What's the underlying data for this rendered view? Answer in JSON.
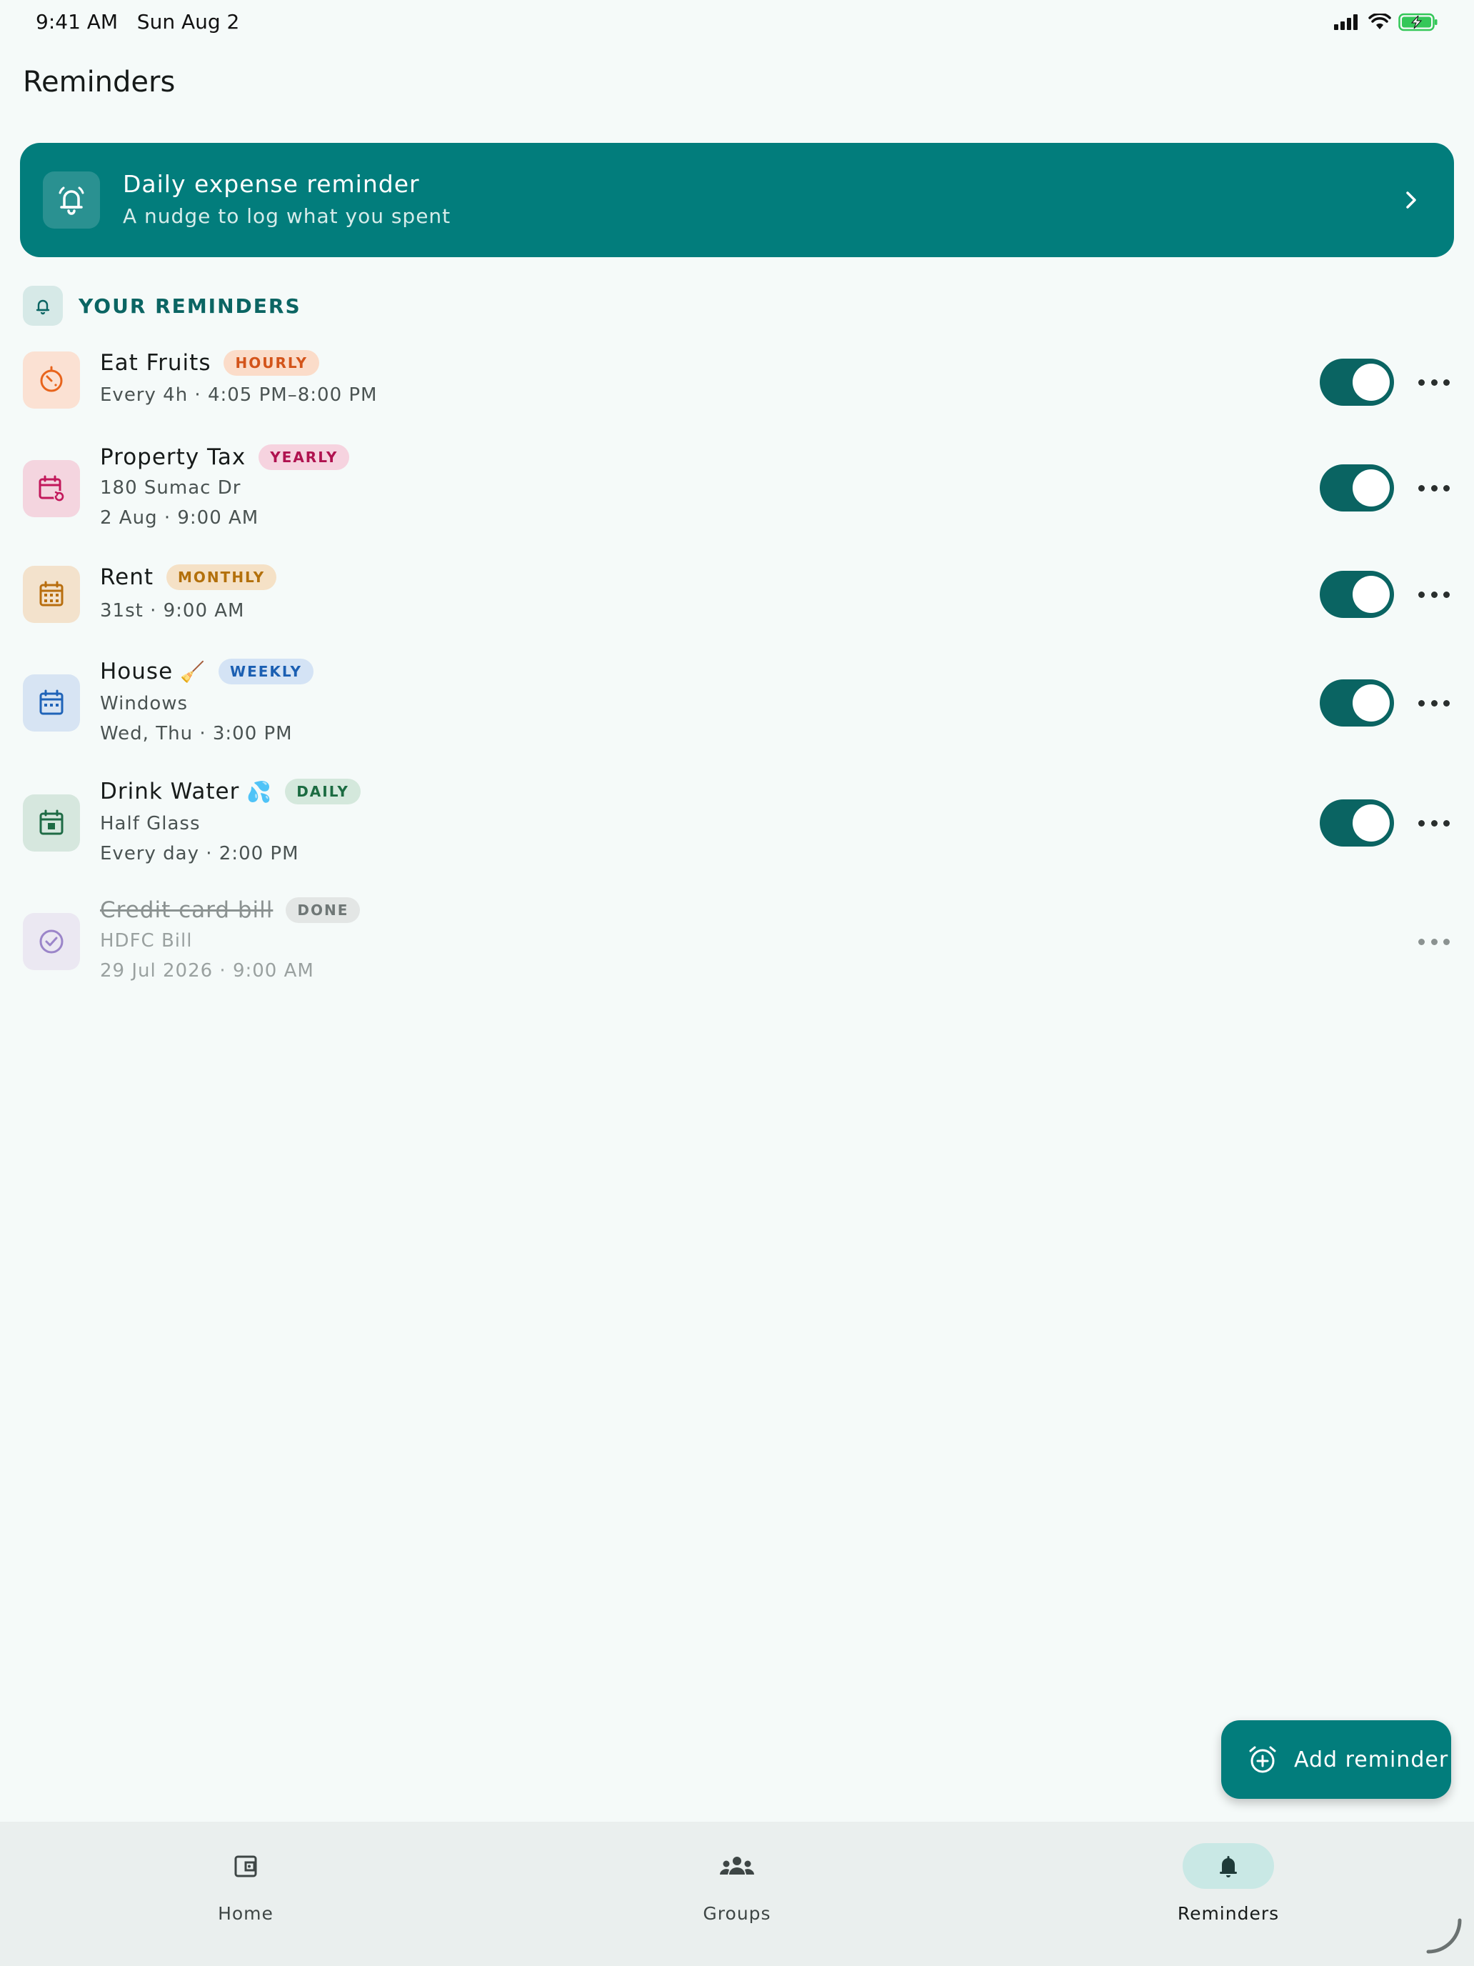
{
  "status_bar": {
    "time": "9:41 AM",
    "date": "Sun Aug 2"
  },
  "page": {
    "title": "Reminders"
  },
  "banner": {
    "title": "Daily expense reminder",
    "subtitle": "A nudge to log what you spent",
    "icon": "alarm-bell-icon"
  },
  "section": {
    "label": "YOUR REMINDERS",
    "icon": "bell-icon"
  },
  "reminders": [
    {
      "title": "Eat Fruits",
      "emoji": "",
      "badge": "HOURLY",
      "line1": "Every 4h · 4:05 PM–8:00 PM",
      "line2": "",
      "enabled": true,
      "icon": "timer-icon",
      "color": "#e8641c"
    },
    {
      "title": "Property Tax",
      "emoji": "",
      "badge": "YEARLY",
      "line1": "180 Sumac Dr",
      "line2": "2 Aug · 9:00 AM",
      "enabled": true,
      "icon": "calendar-repeat-icon",
      "color": "#c2185b"
    },
    {
      "title": "Rent",
      "emoji": "",
      "badge": "MONTHLY",
      "line1": "31st · 9:00 AM",
      "line2": "",
      "enabled": true,
      "icon": "calendar-month-icon",
      "color": "#b86e0e"
    },
    {
      "title": "House",
      "emoji": "🧹",
      "badge": "WEEKLY",
      "line1": "Windows",
      "line2": "Wed, Thu · 3:00 PM",
      "enabled": true,
      "icon": "calendar-week-icon",
      "color": "#1f63b8"
    },
    {
      "title": "Drink Water",
      "emoji": "💦",
      "badge": "DAILY",
      "line1": "Half Glass",
      "line2": "Every day · 2:00 PM",
      "enabled": true,
      "icon": "calendar-today-icon",
      "color": "#1e6b45"
    },
    {
      "title": "Credit card bill",
      "emoji": "",
      "badge": "DONE",
      "line1": "HDFC Bill",
      "line2": "29 Jul 2026 · 9:00 AM",
      "enabled": false,
      "icon": "check-circle-icon",
      "color": "#9b85c9"
    }
  ],
  "fab": {
    "label": "Add reminder",
    "icon": "add-alarm-icon"
  },
  "nav": {
    "home": "Home",
    "groups": "Groups",
    "reminders": "Reminders",
    "active": "reminders"
  }
}
